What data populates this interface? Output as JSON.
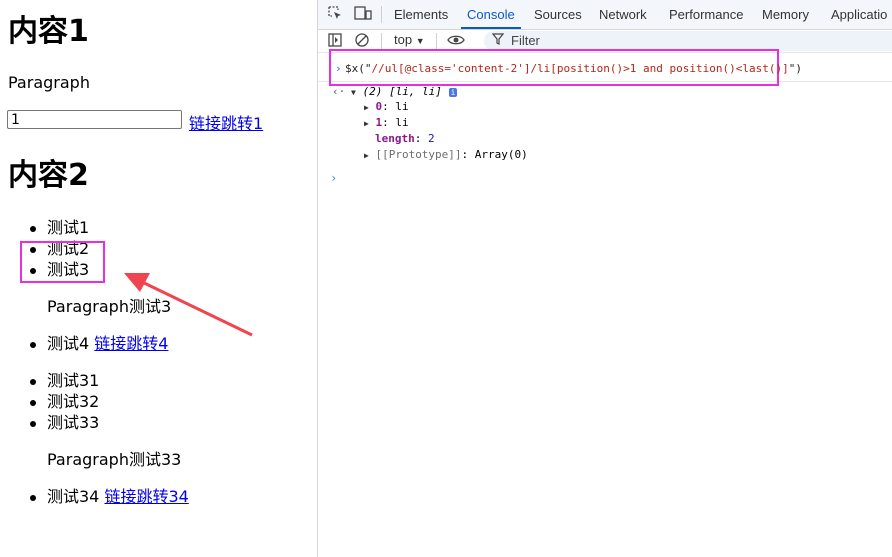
{
  "page": {
    "heading1": "内容1",
    "paragraph": "Paragraph",
    "input_value": "1",
    "link1": "链接跳转1",
    "heading2": "内容2",
    "list1": [
      "测试1",
      "测试2",
      "测试3"
    ],
    "paragraph3": "Paragraph测试3",
    "list2_item": "测试4",
    "link4": "链接跳转4",
    "list3": [
      "测试31",
      "测试32",
      "测试33"
    ],
    "paragraph33": "Paragraph测试33",
    "list4_item": "测试34",
    "link34": "链接跳转34"
  },
  "devtools": {
    "tabs": [
      "Elements",
      "Console",
      "Sources",
      "Network",
      "Performance",
      "Memory",
      "Applicatio"
    ],
    "active_tab": "Console",
    "context": "top",
    "filter_placeholder": "Filter",
    "command": {
      "prefix": "$x(\"",
      "xpath": "//ul[@class='content-2']/li[position()>1 and position()<last()]",
      "suffix": "\")"
    },
    "result": {
      "summary": "(2) [li, li]",
      "items": [
        {
          "key": "0",
          "value": "li"
        },
        {
          "key": "1",
          "value": "li"
        }
      ],
      "length_key": "length",
      "length_value": "2",
      "prototype": "[[Prototype]]",
      "prototype_value": "Array(0)"
    }
  },
  "annotation_color": "#e62ee6",
  "arrow_color": "#f0454f"
}
